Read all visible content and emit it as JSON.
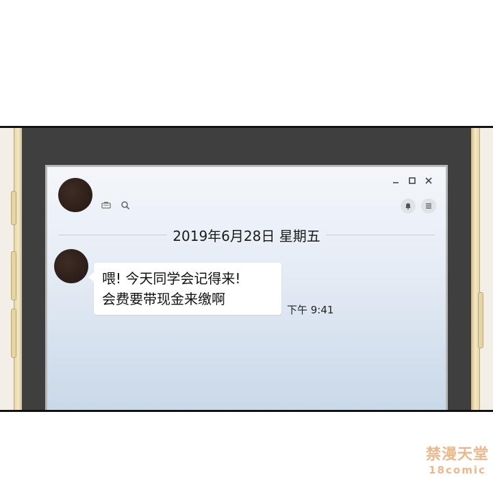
{
  "chat": {
    "date_divider": "2019年6月28日 星期五",
    "message": {
      "line1": "喂! 今天同学会记得来!",
      "line2": "会费要带现金来缴啊",
      "time": "下午  9:41"
    }
  },
  "window_controls": {
    "minimize": "–",
    "maximize": "□",
    "close": "×"
  },
  "icons": {
    "header_left": [
      "keyboard-icon",
      "search-icon"
    ],
    "header_right": [
      "bell-icon",
      "menu-icon"
    ]
  },
  "watermark": {
    "top": "禁漫天堂",
    "bottom": "18comic"
  },
  "colors": {
    "phone_body": "#3f3f3f",
    "phone_edge": "#f4e8c6",
    "screen_top": "#f4f6fa",
    "screen_bottom": "#c9d8e8",
    "bubble": "#ffffff",
    "watermark": "#eab88d"
  }
}
